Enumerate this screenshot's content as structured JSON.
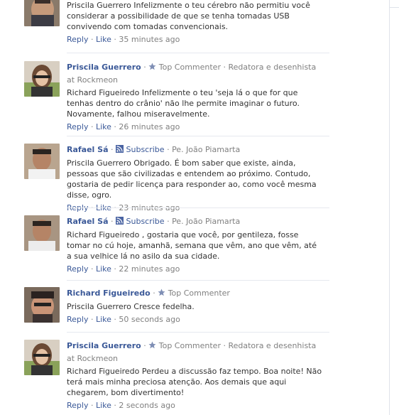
{
  "comments": [
    {
      "name": "",
      "text": "Priscila Guerrero Infelizmente o teu cérebro não permitiu você considerar a possibilidade de que se tenha tomadas USB convivendo com tomadas convencionais.",
      "reply": "Reply",
      "like": "Like",
      "time": "35 minutes ago"
    },
    {
      "name": "Priscila Guerrero",
      "badge": "Top Commenter",
      "meta": "Redatora e desenhista at Rockmeon",
      "text": "Richard Figueiredo Infelizmente o teu 'seja lá o que for que tenhas dentro do crânio' não lhe permite imaginar o futuro. Novamente, falhou miseravelmente.",
      "reply": "Reply",
      "like": "Like",
      "time": "26 minutes ago"
    },
    {
      "name": "Rafael Sá",
      "subscribe": "Subscribe",
      "meta": "Pe. João Piamarta",
      "text": "Priscila Guerrero Obrigado. É bom saber que existe, ainda, pessoas que são civilizadas e entendem ao próximo. Contudo, gostaria de pedir licença para responder ao, como você mesma disse, ogro.",
      "reply": "Reply",
      "like": "Like",
      "time": "23 minutes ago"
    },
    {
      "name": "Rafael Sá",
      "subscribe": "Subscribe",
      "meta": "Pe. João Piamarta",
      "text": "Richard Figueiredo , gostaria que você, por gentileza, fosse tomar no cú hoje, amanhã, semana que vêm, ano que vêm, até a sua velhice lá no asilo da sua cidade.",
      "reply": "Reply",
      "like": "Like",
      "time": "22 minutes ago"
    },
    {
      "name": "Richard Figueiredo",
      "badge": "Top Commenter",
      "text": "Priscila Guerrero Cresce fedelha.",
      "reply": "Reply",
      "like": "Like",
      "time": "50 seconds ago"
    },
    {
      "name": "Priscila Guerrero",
      "badge": "Top Commenter",
      "meta": "Redatora e desenhista at Rockmeon",
      "text": "Richard Figueiredo Perdeu a discussão faz tempo. Boa noite! Não terá mais minha preciosa atenção. Aos demais que aqui chegarem, bom divertimento!",
      "reply": "Reply",
      "like": "Like",
      "time": "2 seconds ago"
    }
  ],
  "dot": "·"
}
